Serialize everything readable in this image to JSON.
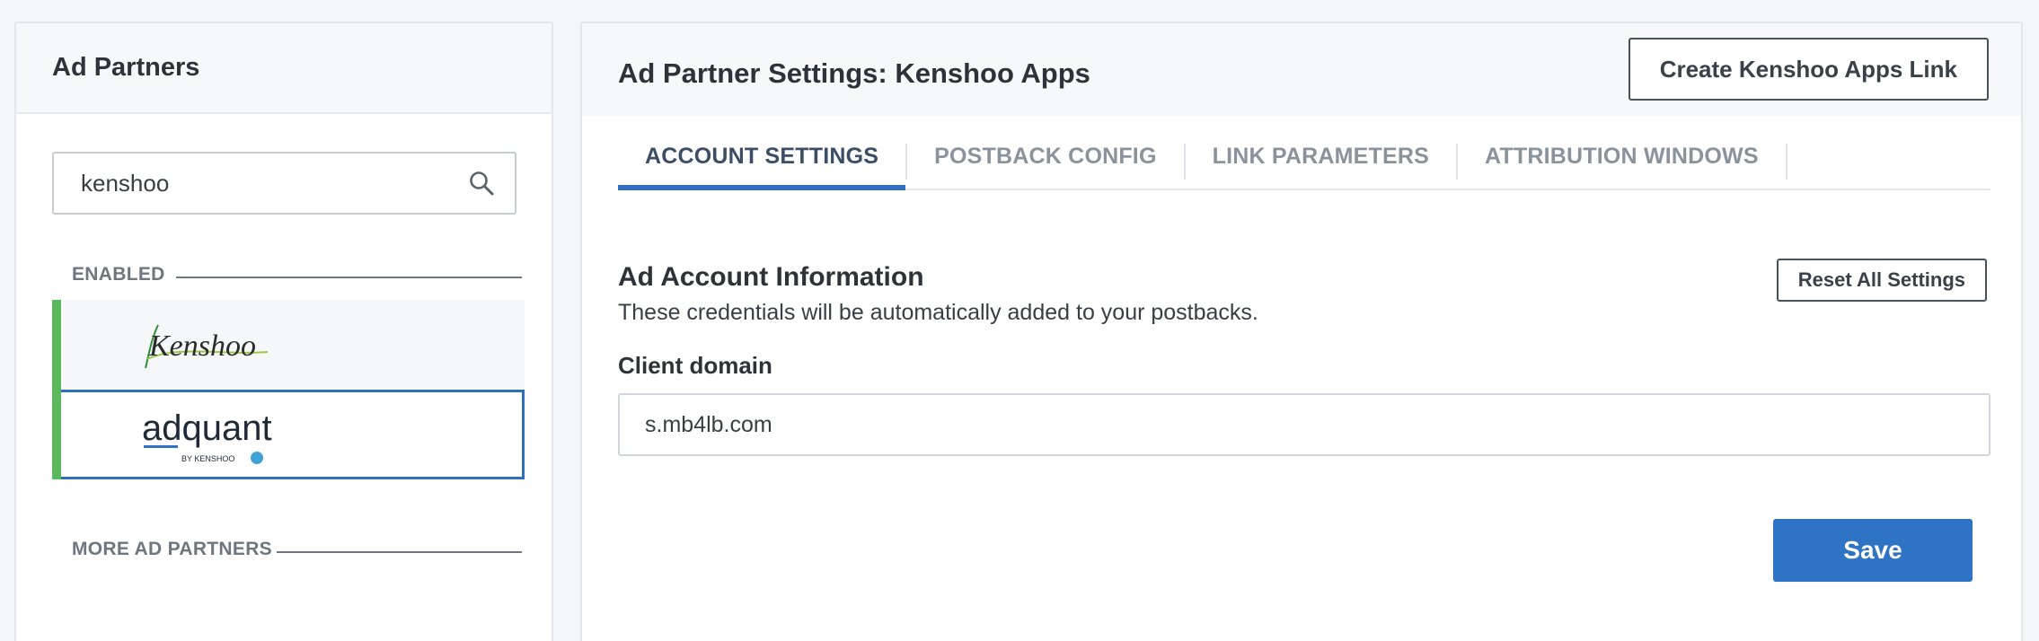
{
  "left_panel": {
    "title": "Ad Partners",
    "search": {
      "value": "kenshoo",
      "placeholder": ""
    },
    "enabled_label": "ENABLED",
    "more_label": "MORE AD PARTNERS",
    "partners": [
      {
        "name": "Kenshoo",
        "logo_text": "Kenshoo",
        "status": "enabled",
        "selected": false
      },
      {
        "name": "adquant",
        "logo_text": "adquant",
        "logo_subtext": "BY KENSHOO",
        "status": "enabled",
        "selected": true
      }
    ]
  },
  "right_panel": {
    "title": "Ad Partner Settings: Kenshoo Apps",
    "create_link_label": "Create Kenshoo Apps Link",
    "tabs": [
      {
        "label": "ACCOUNT SETTINGS",
        "active": true
      },
      {
        "label": "POSTBACK CONFIG",
        "active": false
      },
      {
        "label": "LINK PARAMETERS",
        "active": false
      },
      {
        "label": "ATTRIBUTION WINDOWS",
        "active": false
      }
    ],
    "section_title": "Ad Account Information",
    "section_desc": "These credentials will be automatically added to your postbacks.",
    "reset_label": "Reset All Settings",
    "field_label": "Client domain",
    "client_domain": "s.mb4lb.com",
    "save_label": "Save"
  },
  "colors": {
    "accent_blue": "#2f73c4",
    "enabled_green": "#5cb85c",
    "selected_border": "#2f6fbe"
  }
}
